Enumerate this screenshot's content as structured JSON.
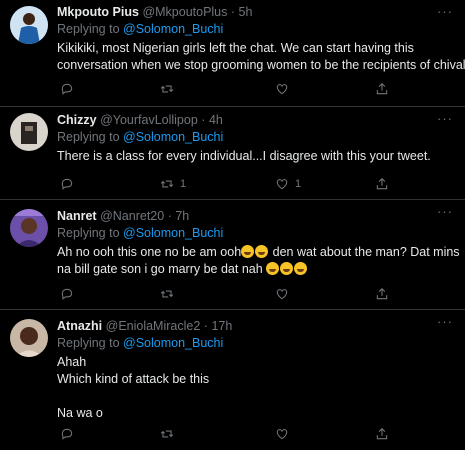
{
  "tweets": [
    {
      "name": "Mkpouto Pius",
      "handle": "@MkpoutoPlus",
      "sep": "·",
      "time": "5h",
      "replying_to": "Replying to",
      "mention": "@Solomon_Buchi",
      "lines": [
        "Kikikiki, most Nigerian girls left the chat. We can start having this",
        "conversation when we stop grooming women to be the recipients of chivalry"
      ],
      "retweets": "",
      "likes": ""
    },
    {
      "name": "Chizzy",
      "handle": "@YourfavLollipop",
      "sep": "·",
      "time": "4h",
      "replying_to": "Replying to",
      "mention": "@Solomon_Buchi",
      "lines": [
        "There is a class for every individual...I disagree with this your tweet."
      ],
      "retweets": "1",
      "likes": "1"
    },
    {
      "name": "Nanret",
      "handle": "@Nanret20",
      "sep": "·",
      "time": "7h",
      "replying_to": "Replying to",
      "mention": "@Solomon_Buchi",
      "line1_a": "Ah no ooh this one no be am ooh",
      "line1_b": " den wat about the man? Dat mins",
      "line2_a": "na bill gate son i go marry be dat nah",
      "retweets": "",
      "likes": ""
    },
    {
      "name": "Atnazhi",
      "handle": "@EniolaMiracle2",
      "sep": "·",
      "time": "17h",
      "replying_to": "Replying to",
      "mention": "@Solomon_Buchi",
      "lines": [
        "Ahah",
        "Which kind of attack be this",
        "",
        "Na wa o"
      ],
      "retweets": "",
      "likes": ""
    }
  ],
  "more_glyph": "···",
  "colors": {
    "background": "#000000",
    "text": "#e7e9ea",
    "muted": "#71767b",
    "link": "#1d9bf0",
    "divider": "#2f3336"
  }
}
